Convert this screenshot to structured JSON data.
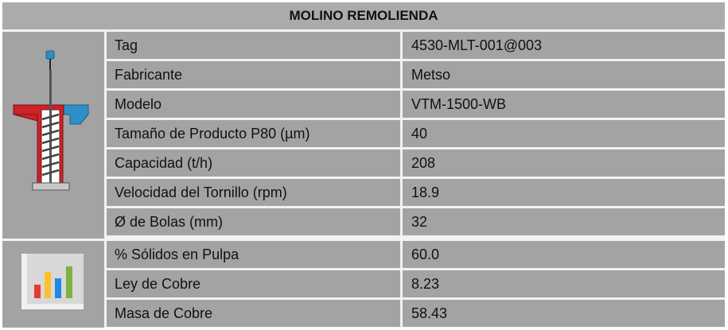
{
  "title": "MOLINO REMOLIENDA",
  "icons": {
    "machine": "vertical-mill-icon",
    "chart": "bar-chart-icon"
  },
  "colors": {
    "header_bg": "#ababab",
    "cell_bg": "#a3a3a3",
    "grid_lines": "#f2f2f2",
    "mill_body": "#cc2229",
    "mill_hopper": "#2f8fc8",
    "bar_red": "#e53935",
    "bar_yellow": "#fbc02d",
    "bar_blue": "#1e88e5",
    "bar_green": "#7cb342"
  },
  "rows": [
    {
      "label": "Tag",
      "value": "4530-MLT-001@003"
    },
    {
      "label": "Fabricante",
      "value": "Metso"
    },
    {
      "label": "Modelo",
      "value": "VTM-1500-WB"
    },
    {
      "label": "Tamaño de Producto P80 (µm)",
      "value": "40"
    },
    {
      "label": "Capacidad (t/h)",
      "value": "208"
    },
    {
      "label": "Velocidad del Tornillo (rpm)",
      "value": "18.9"
    },
    {
      "label": "Ø de Bolas (mm)",
      "value": "32"
    },
    {
      "label": "% Sólidos en Pulpa",
      "value": "60.0"
    },
    {
      "label": "Ley de Cobre",
      "value": "8.23"
    },
    {
      "label": "Masa de Cobre",
      "value": "58.43"
    }
  ]
}
